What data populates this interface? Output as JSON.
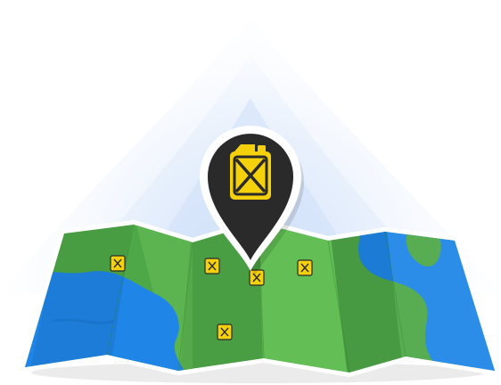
{
  "illustration": {
    "subject": "folded-map",
    "pin_icon": "fuel-jerrycan-icon",
    "marker_icon": "fuel-jerrycan-icon",
    "marker_count": 6
  },
  "colors": {
    "background": "#ffffff",
    "glow": "#dbe8fb",
    "water": "#1f86e8",
    "water_dark": "#1a74cf",
    "land": "#4ea848",
    "land_light": "#62be55",
    "land_dark": "#3f9739",
    "pin_body": "#2a2a2a",
    "pin_border": "#ffffff",
    "fuel_yellow": "#f5d10b",
    "fuel_dark": "#2a2a2a"
  }
}
